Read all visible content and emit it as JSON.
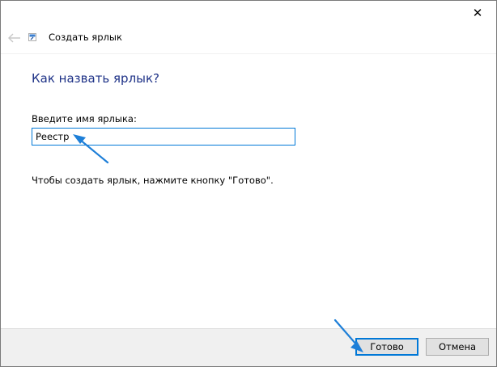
{
  "window": {
    "title": "Создать ярлык",
    "close_glyph": "✕",
    "back_icon": "arrow-left-icon"
  },
  "content": {
    "heading": "Как назвать ярлык?",
    "field_label": "Введите имя ярлыка:",
    "field_value": "Реестр",
    "hint": "Чтобы создать ярлык, нажмите кнопку \"Готово\"."
  },
  "footer": {
    "finish_label": "Готово",
    "cancel_label": "Отмена"
  },
  "colors": {
    "accent": "#0078d7",
    "heading": "#1e3287",
    "annotation_arrow": "#1e7fd8"
  }
}
